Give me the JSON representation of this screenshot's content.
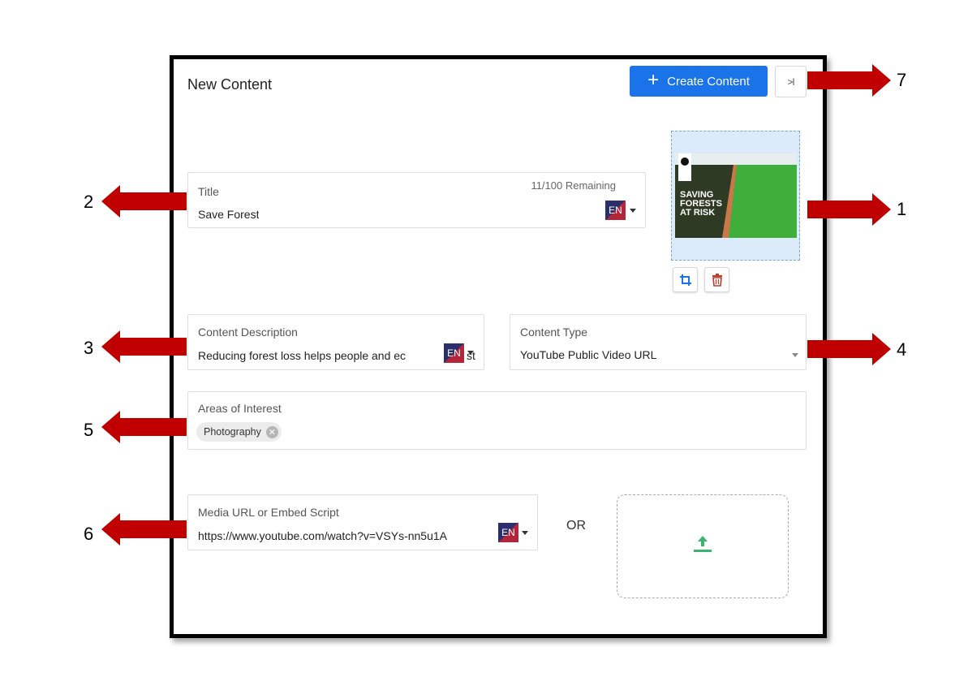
{
  "header": {
    "title": "New Content",
    "create_button_label": "Create Content",
    "collapse_button_label": ">I"
  },
  "title_field": {
    "label": "Title",
    "value": "Save Forest",
    "remaining": "11/100 Remaining",
    "language": "EN"
  },
  "description_field": {
    "label": "Content Description",
    "value": "Reducing forest loss helps people and ec",
    "value_tail": "st",
    "language": "EN"
  },
  "content_type_field": {
    "label": "Content Type",
    "value": "YouTube Public Video URL"
  },
  "interests_field": {
    "label": "Areas of Interest",
    "chips": [
      "Photography"
    ]
  },
  "media_field": {
    "label": "Media URL or Embed Script",
    "value": "https://www.youtube.com/watch?v=VSYs-nn5u1A",
    "language": "EN"
  },
  "or_text": "OR",
  "thumbnail": {
    "lines": [
      "SAVING",
      "FORESTS",
      "AT RISK"
    ]
  },
  "callouts": [
    "1",
    "2",
    "3",
    "4",
    "5",
    "6",
    "7"
  ],
  "colors": {
    "primary": "#1a73e8",
    "arrow": "#c00000",
    "upload_icon": "#3cb371",
    "delete_icon": "#c0392b"
  }
}
